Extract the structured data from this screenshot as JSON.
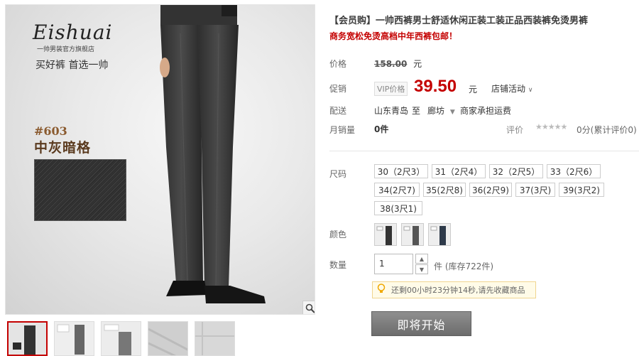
{
  "gallery": {
    "brand_logo": "Eishuai",
    "brand_sub": "一帅男装官方旗舰店",
    "brand_slogan": "买好裤 首选一帅",
    "product_code": "#603",
    "color_name": "中灰暗格",
    "zoom_icon": "magnifier-icon",
    "thumbnails": [
      "thumb-1",
      "thumb-2",
      "thumb-3",
      "thumb-4",
      "thumb-5"
    ],
    "active_thumbnail": 0
  },
  "product": {
    "title": "【会员购】一帅西裤男士舒适休闲正装工装正品西装裤免烫男裤",
    "subtitle": "商务宽松免烫高档中年西裤包邮！"
  },
  "price": {
    "label": "价格",
    "original": "158.00",
    "currency": "元"
  },
  "promo": {
    "label": "促销",
    "tag": "VIP价格",
    "price": "39.50",
    "currency": "元",
    "shop_activity": "店铺活动"
  },
  "shipping": {
    "label": "配送",
    "from": "山东青岛",
    "to_word": "至",
    "destination": "廊坊",
    "fee_note": "商家承担运费"
  },
  "sales": {
    "label": "月销量",
    "count": "0件",
    "rating_label": "评价",
    "stars": "★★★★★",
    "rating_value": "0分(累计评价0)"
  },
  "sizes": {
    "label": "尺码",
    "options": [
      "30（2尺3）",
      "31（2尺4）",
      "32（2尺5）",
      "33（2尺6）",
      "34(2尺7)",
      "35(2尺8)",
      "36(2尺9)",
      "37(3尺)",
      "39(3尺2)",
      "38(3尺1)"
    ]
  },
  "colors": {
    "label": "颜色",
    "options": [
      "color-1",
      "color-2",
      "color-3"
    ]
  },
  "quantity": {
    "label": "数量",
    "value": "1",
    "stock_text": "件 (库存722件)"
  },
  "countdown": {
    "text": "还剩00小时23分钟14秒,请先收藏商品",
    "icon": "lightbulb-icon"
  },
  "buy_button": {
    "label": "即将开始"
  },
  "colors_hex": {
    "accent": "#c40000",
    "button": "#777777",
    "notice_bg": "#fffbe8"
  }
}
